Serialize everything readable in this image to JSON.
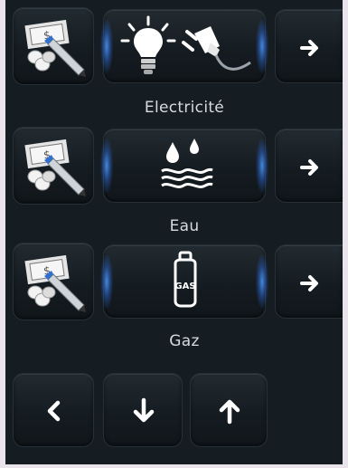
{
  "rows": [
    {
      "label": "Electricité",
      "pay_icon": "bill-and-coins-pencil-icon",
      "meter_icons": [
        "light-bulb-icon",
        "power-plug-icon"
      ],
      "next_icon": "arrow-right-icon"
    },
    {
      "label": "Eau",
      "pay_icon": "bill-and-coins-pencil-icon",
      "meter_icons": [
        "water-icon"
      ],
      "next_icon": "arrow-right-icon"
    },
    {
      "label": "Gaz",
      "pay_icon": "bill-and-coins-pencil-icon",
      "meter_icons": [
        "gas-bottle-icon"
      ],
      "next_icon": "arrow-right-icon",
      "gas_bottle_text": "GAS"
    }
  ],
  "nav": {
    "icons": [
      "chevron-left-icon",
      "arrow-down-icon",
      "arrow-up-icon"
    ]
  },
  "colors": {
    "panel": "#151d22",
    "glow": "#3a7fd8",
    "icon": "#ffffff",
    "page": "#e9e3ec"
  }
}
